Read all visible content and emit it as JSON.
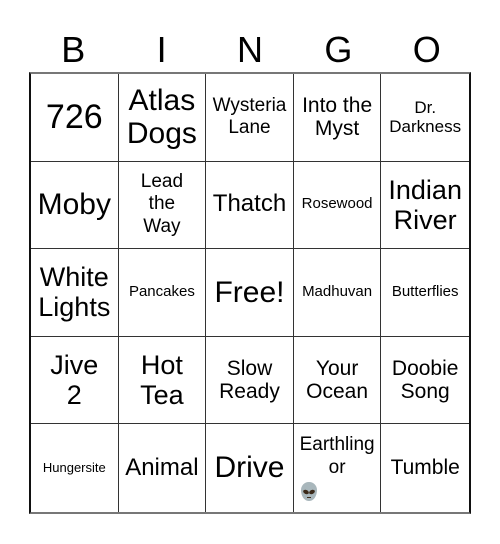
{
  "header": {
    "letters": [
      "B",
      "I",
      "N",
      "G",
      "O"
    ]
  },
  "cells": [
    [
      "726"
    ],
    [
      "Atlas",
      "Dogs"
    ],
    [
      "Wysteria",
      "Lane"
    ],
    [
      "Into the",
      "Myst"
    ],
    [
      "Dr.",
      "Darkness"
    ],
    [
      "Moby"
    ],
    [
      "Lead",
      "the",
      "Way"
    ],
    [
      "Thatch"
    ],
    [
      "Rosewood"
    ],
    [
      "Indian",
      "River"
    ],
    [
      "White",
      "Lights"
    ],
    [
      "Pancakes"
    ],
    [
      "Free!"
    ],
    [
      "Madhuvan"
    ],
    [
      "Butterflies"
    ],
    [
      "Jive",
      "2"
    ],
    [
      "Hot",
      "Tea"
    ],
    [
      "Slow",
      "Ready"
    ],
    [
      "Your",
      "Ocean"
    ],
    [
      "Doobie",
      "Song"
    ],
    [
      "Hungersite"
    ],
    [
      "Animal"
    ],
    [
      "Drive"
    ],
    [
      "Earthling",
      "or"
    ],
    [
      "Tumble"
    ]
  ],
  "icons": {
    "earthling_cell_icon": "alien-emoji"
  }
}
